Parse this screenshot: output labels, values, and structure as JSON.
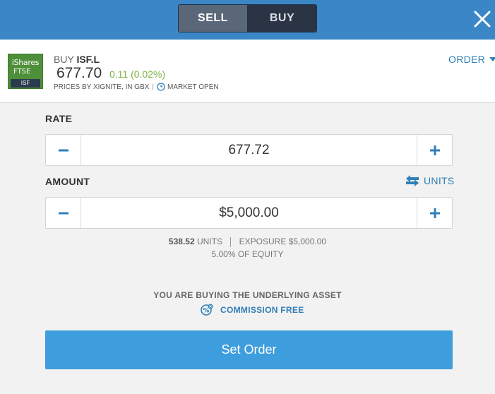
{
  "header": {
    "sell_label": "SELL",
    "buy_label": "BUY",
    "accent_color": "#3a86c6"
  },
  "instrument": {
    "logo": {
      "line1": "iShares",
      "line2": "FTSE",
      "tag": "ISF"
    },
    "action": "BUY",
    "symbol": "ISF.L",
    "price": "677.70",
    "change": "0.11 (0.02%)",
    "prices_by": "PRICES BY XIGNITE, IN GBX",
    "separator": "|",
    "market_status": "MARKET OPEN",
    "order_type_label": "ORDER"
  },
  "rate": {
    "label": "RATE",
    "value": "677.72"
  },
  "amount": {
    "label": "AMOUNT",
    "value": "$5,000.00",
    "units_toggle_label": "UNITS"
  },
  "summary": {
    "units_value": "538.52",
    "units_label": "UNITS",
    "exposure_label": "EXPOSURE",
    "exposure_value": "$5,000.00",
    "equity_value": "5.00%",
    "equity_label": "OF EQUITY"
  },
  "notice": {
    "underlying": "YOU ARE BUYING THE UNDERLYING ASSET",
    "commission": "COMMISSION FREE"
  },
  "actions": {
    "set_order_label": "Set Order",
    "button_color": "#3d9ddd"
  },
  "icons": {
    "close": "close-icon",
    "clock": "clock-icon",
    "minus": "minus-icon",
    "plus": "plus-icon",
    "swap": "swap-arrows-icon",
    "commission": "commission-icon"
  }
}
